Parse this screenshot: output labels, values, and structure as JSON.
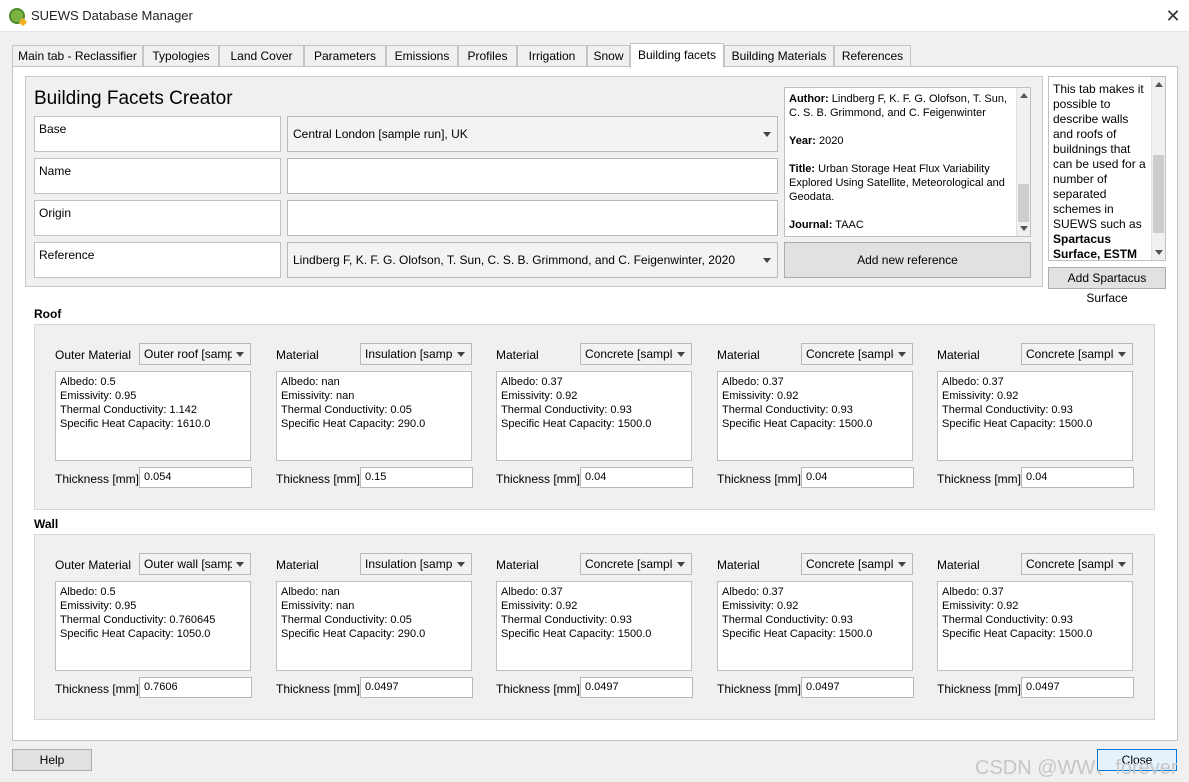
{
  "window": {
    "title": "SUEWS Database Manager",
    "close_glyph": "✕"
  },
  "tabs": [
    "Main tab - Reclassifier",
    "Typologies",
    "Land Cover",
    "Parameters",
    "Emissions",
    "Profiles",
    "Irrigation",
    "Snow",
    "Building facets",
    "Building Materials",
    "References"
  ],
  "active_tab": "Building facets",
  "creator": {
    "title": "Building Facets Creator",
    "base_label": "Base",
    "base_value": "Central London [sample run], UK",
    "name_label": "Name",
    "name_value": "",
    "origin_label": "Origin",
    "origin_value": "",
    "reference_label": "Reference",
    "reference_value": "Lindberg F, K. F. G. Olofson, T. Sun, C. S. B. Grimmond, and C. Feigenwinter, 2020",
    "add_reference_button": "Add new reference"
  },
  "ref_preview": {
    "author_label": "Author:",
    "author": "Lindberg F, K. F. G. Olofson, T. Sun, C. S. B. Grimmond, and C. Feigenwinter",
    "year_label": "Year:",
    "year": "2020",
    "title_label": "Title:",
    "title": "Urban Storage Heat Flux Variability Explored Using Satellite, Meteorological and Geodata.",
    "journal_label": "Journal:",
    "journal": "TAAC"
  },
  "info": {
    "text": "This tab makes it possible to describe walls and roofs of buildnings that can be used for a number of separated schemes in SUEWS such as",
    "bold": "Spartacus Surface, ESTM",
    "button": "Add Spartacus Surface"
  },
  "roof": {
    "label": "Roof",
    "thickness_label": "Thickness [mm]",
    "layers": [
      {
        "material_label": "Outer Material",
        "material": "Outer roof [sampl",
        "albedo": "Albedo: 0.5",
        "emissivity": "Emissivity: 0.95",
        "conductivity": "Thermal Conductivity: 1.142",
        "heat_capacity": "Specific Heat Capacity: 1610.0",
        "thickness": "0.054"
      },
      {
        "material_label": "Material",
        "material": "Insulation [sampl",
        "albedo": "Albedo: nan",
        "emissivity": "Emissivity: nan",
        "conductivity": "Thermal Conductivity: 0.05",
        "heat_capacity": "Specific Heat Capacity: 290.0",
        "thickness": "0.15"
      },
      {
        "material_label": "Material",
        "material": "Concrete [sample",
        "albedo": "Albedo: 0.37",
        "emissivity": "Emissivity: 0.92",
        "conductivity": "Thermal Conductivity: 0.93",
        "heat_capacity": "Specific Heat Capacity: 1500.0",
        "thickness": "0.04"
      },
      {
        "material_label": "Material",
        "material": "Concrete [sample",
        "albedo": "Albedo: 0.37",
        "emissivity": "Emissivity: 0.92",
        "conductivity": "Thermal Conductivity: 0.93",
        "heat_capacity": "Specific Heat Capacity: 1500.0",
        "thickness": "0.04"
      },
      {
        "material_label": "Material",
        "material": "Concrete [sample",
        "albedo": "Albedo: 0.37",
        "emissivity": "Emissivity: 0.92",
        "conductivity": "Thermal Conductivity: 0.93",
        "heat_capacity": "Specific Heat Capacity: 1500.0",
        "thickness": "0.04"
      }
    ]
  },
  "wall": {
    "label": "Wall",
    "thickness_label": "Thickness [mm]",
    "layers": [
      {
        "material_label": "Outer Material",
        "material": "Outer wall [sampl",
        "albedo": "Albedo: 0.5",
        "emissivity": "Emissivity: 0.95",
        "conductivity": "Thermal Conductivity: 0.760645",
        "heat_capacity": "Specific Heat Capacity: 1050.0",
        "thickness": "0.7606"
      },
      {
        "material_label": "Material",
        "material": "Insulation [sampl",
        "albedo": "Albedo: nan",
        "emissivity": "Emissivity: nan",
        "conductivity": "Thermal Conductivity: 0.05",
        "heat_capacity": "Specific Heat Capacity: 290.0",
        "thickness": "0.0497"
      },
      {
        "material_label": "Material",
        "material": "Concrete [sample",
        "albedo": "Albedo: 0.37",
        "emissivity": "Emissivity: 0.92",
        "conductivity": "Thermal Conductivity: 0.93",
        "heat_capacity": "Specific Heat Capacity: 1500.0",
        "thickness": "0.0497"
      },
      {
        "material_label": "Material",
        "material": "Concrete [sample",
        "albedo": "Albedo: 0.37",
        "emissivity": "Emissivity: 0.92",
        "conductivity": "Thermal Conductivity: 0.93",
        "heat_capacity": "Specific Heat Capacity: 1500.0",
        "thickness": "0.0497"
      },
      {
        "material_label": "Material",
        "material": "Concrete [sample",
        "albedo": "Albedo: 0.37",
        "emissivity": "Emissivity: 0.92",
        "conductivity": "Thermal Conductivity: 0.93",
        "heat_capacity": "Specific Heat Capacity: 1500.0",
        "thickness": "0.0497"
      }
    ]
  },
  "footer": {
    "help_button": "Help",
    "close_button": "Close"
  },
  "watermark": "CSDN @WW、forever"
}
